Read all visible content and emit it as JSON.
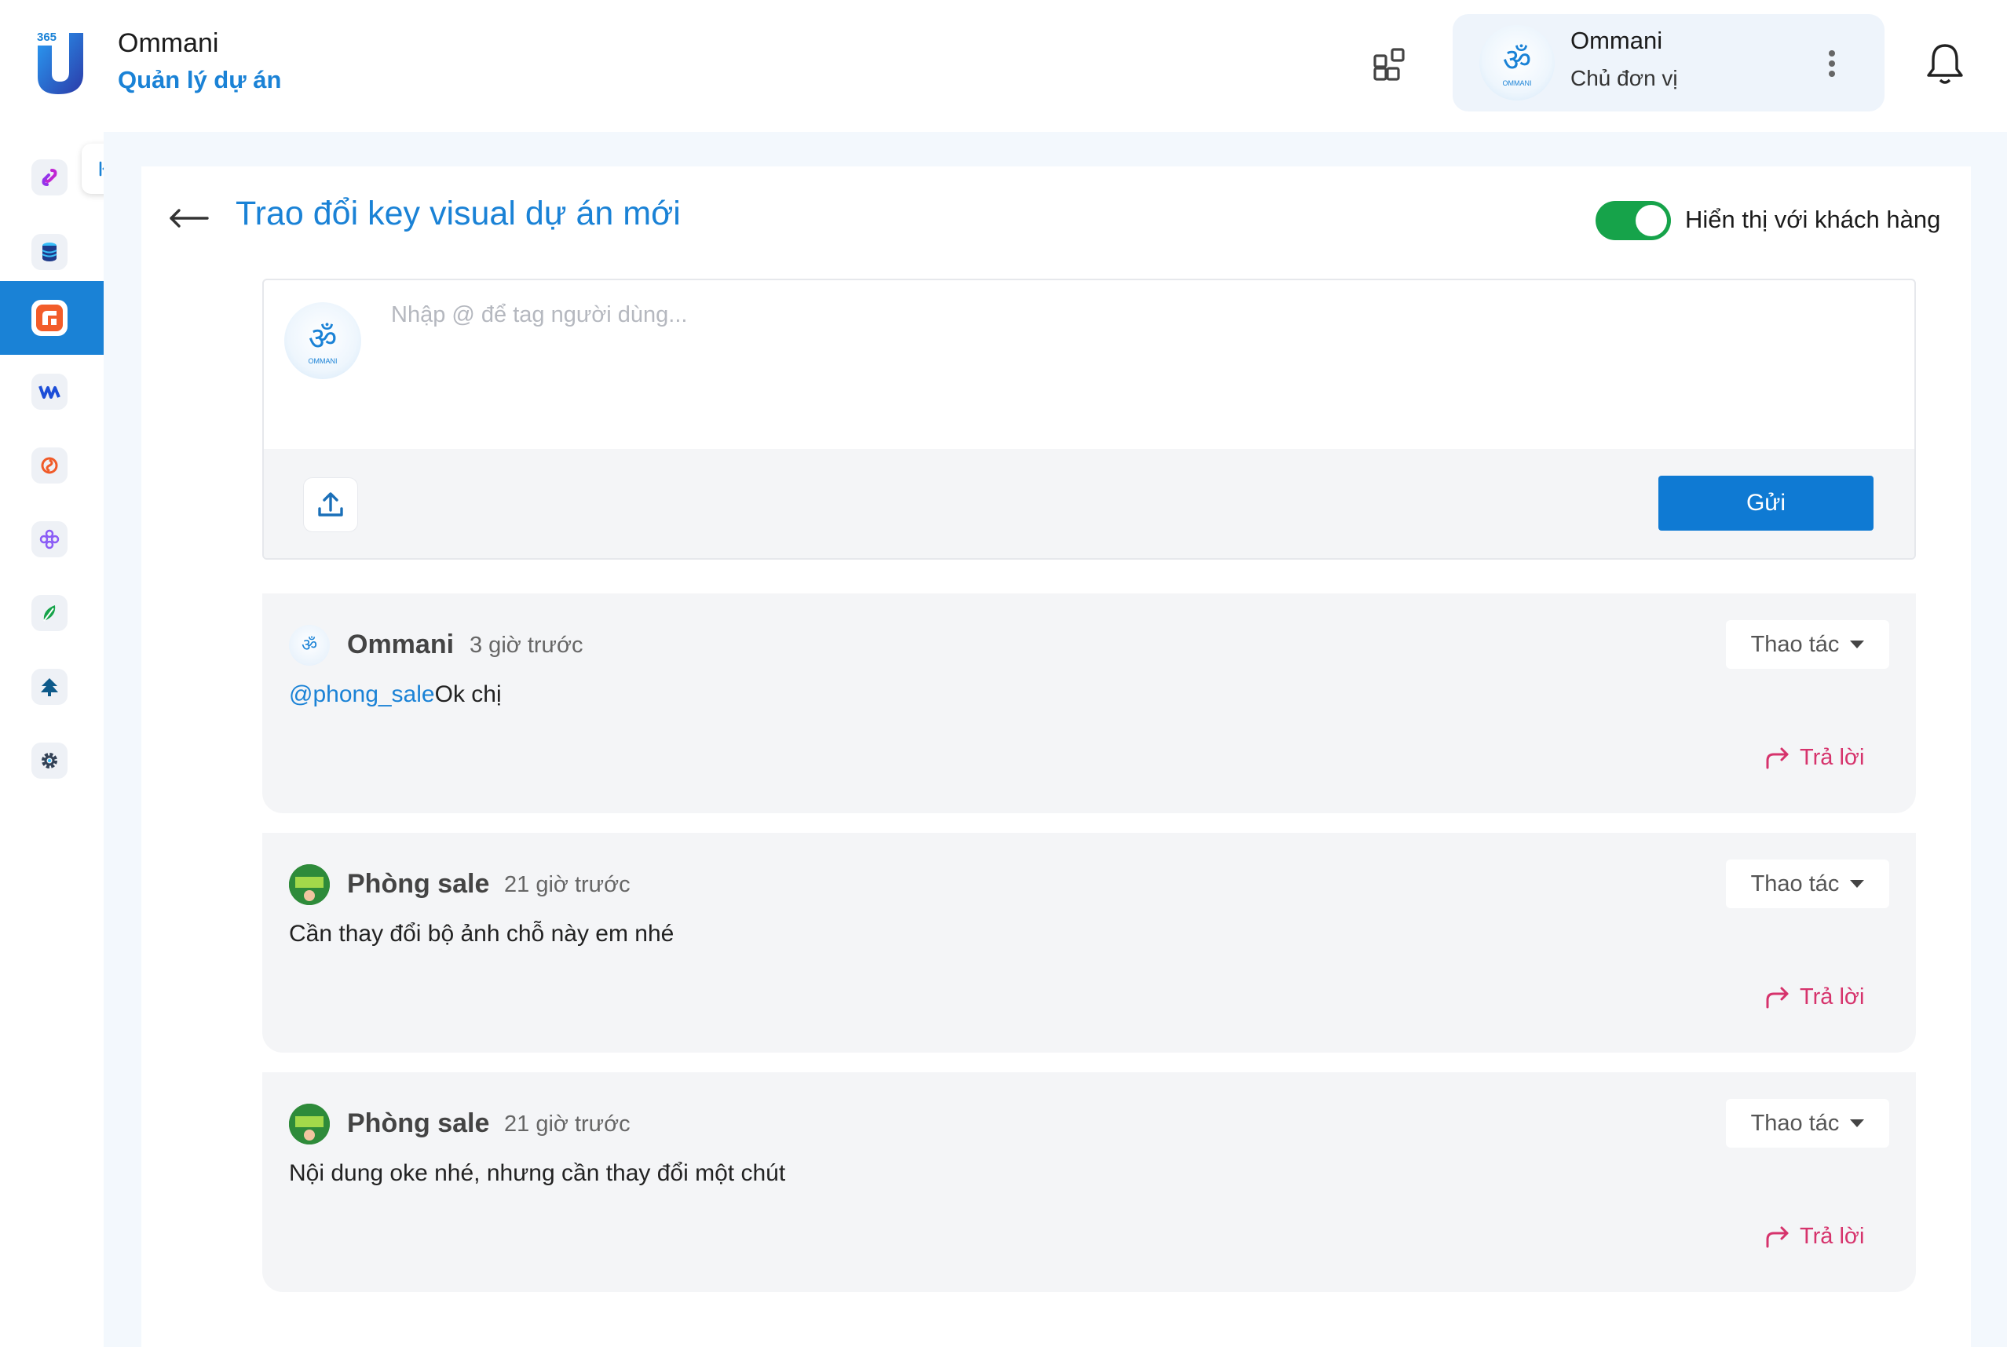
{
  "header": {
    "brand_name": "Ommani",
    "brand_subtitle": "Quản lý dự án",
    "logo_badge": "365",
    "user": {
      "name": "Ommani",
      "role": "Chủ đơn vị"
    }
  },
  "sidebar": {
    "items": [
      {
        "icon": "link-icon",
        "color": "#c026d3"
      },
      {
        "icon": "database-icon",
        "color": "#1e3a8a"
      },
      {
        "icon": "project-icon",
        "color": "#f25c2a",
        "active": true
      },
      {
        "icon": "wave-icon",
        "color": "#1d4ed8"
      },
      {
        "icon": "spiral-icon",
        "color": "#f05a28"
      },
      {
        "icon": "flower-icon",
        "color": "#8b5cf6"
      },
      {
        "icon": "leaf-icon",
        "color": "#16a34a"
      },
      {
        "icon": "tree-icon",
        "color": "#0e5a8a"
      },
      {
        "icon": "gear-icon",
        "color": "#334155"
      }
    ]
  },
  "page": {
    "title": "Trao đổi key visual dự án mới",
    "toggle_label": "Hiển thị với khách hàng",
    "toggle_on": true
  },
  "composer": {
    "placeholder": "Nhập @ để tag người dùng...",
    "send_label": "Gửi"
  },
  "comments": [
    {
      "author": "Ommani",
      "time": "3 giờ trước",
      "mention": "@phong_sale",
      "text": "Ok chị",
      "action_label": "Thao tác",
      "reply_label": "Trả lời",
      "avatar": "ommani"
    },
    {
      "author": "Phòng sale",
      "time": "21 giờ trước",
      "mention": "",
      "text": "Cần thay đổi bộ ảnh chỗ này em nhé",
      "action_label": "Thao tác",
      "reply_label": "Trả lời",
      "avatar": "sale"
    },
    {
      "author": "Phòng sale",
      "time": "21 giờ trước",
      "mention": "",
      "text": "Nội dung oke nhé, nhưng cần thay đổi một chút",
      "action_label": "Thao tác",
      "reply_label": "Trả lời",
      "avatar": "sale"
    }
  ],
  "colors": {
    "accent": "#1a82d6",
    "send": "#0f7ad3",
    "toggle": "#16a34a",
    "reply": "#d6336c"
  }
}
